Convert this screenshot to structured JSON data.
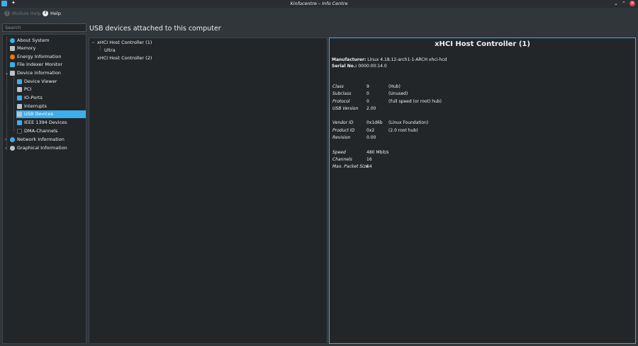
{
  "window": {
    "title": "Kinfocentre – Info Centre",
    "pin_icon": "pin-icon",
    "controls": [
      "minimize-icon",
      "maximize-icon",
      "close-icon"
    ]
  },
  "toolbar": {
    "module_help": "Module Help",
    "help": "Help"
  },
  "search": {
    "placeholder": "Search"
  },
  "sidebar": {
    "items": [
      {
        "label": "About System",
        "icon": "info-icon",
        "color": "#3daee9"
      },
      {
        "label": "Memory",
        "icon": "memory-icon",
        "color": "#bdc3c7"
      },
      {
        "label": "Energy Information",
        "icon": "battery-icon",
        "color": "#f67400"
      },
      {
        "label": "File Indexer Monitor",
        "icon": "indexer-icon",
        "color": "#3daee9"
      },
      {
        "label": "Device Information",
        "icon": "computer-icon",
        "color": "#bdc3c7"
      },
      {
        "label": "Device Viewer",
        "icon": "device-viewer-icon",
        "color": "#3daee9"
      },
      {
        "label": "PCI",
        "icon": "pci-icon",
        "color": "#bdc3c7"
      },
      {
        "label": "IO-Ports",
        "icon": "io-ports-icon",
        "color": "#3daee9"
      },
      {
        "label": "Interrupts",
        "icon": "interrupts-icon",
        "color": "#bdc3c7"
      },
      {
        "label": "USB Devices",
        "icon": "usb-icon",
        "color": "#bdc3c7"
      },
      {
        "label": "IEEE 1394 Devices",
        "icon": "firewire-icon",
        "color": "#3daee9"
      },
      {
        "label": "DMA-Channels",
        "icon": "dma-icon",
        "color": "#1d1f22"
      },
      {
        "label": "Network Information",
        "icon": "network-icon",
        "color": "#3daee9"
      },
      {
        "label": "Graphical Information",
        "icon": "graphics-icon",
        "color": "#bdc3c7"
      }
    ]
  },
  "page_title": "USB devices attached to this computer",
  "devices": [
    {
      "label": "xHCI Host Controller (1)"
    },
    {
      "label": "Ultra"
    },
    {
      "label": "xHCI Host Controller (2)"
    }
  ],
  "details": {
    "title": "xHCI Host Controller (1)",
    "manufacturer_label": "Manufacturer:",
    "manufacturer_value": "Linux 4.18.12-arch1-1-ARCH xhci-hcd",
    "serial_label": "Serial No.:",
    "serial_value": "0000:00:14.0",
    "rows": [
      {
        "k": "Class",
        "v": "9",
        "n": "(Hub)"
      },
      {
        "k": "Subclass",
        "v": "0",
        "n": "(Unused)"
      },
      {
        "k": "Protocol",
        "v": "0",
        "n": "(Full speed (or root) hub)"
      },
      {
        "k": "USB Version",
        "v": "2.00",
        "n": ""
      },
      {
        "k": "Vendor ID",
        "v": "0x1d6b",
        "n": "(Linux Foundation)"
      },
      {
        "k": "Product ID",
        "v": "0x2",
        "n": "(2.0 root hub)"
      },
      {
        "k": "Revision",
        "v": "0.00",
        "n": ""
      },
      {
        "k": "Speed",
        "v": "480 Mbit/s",
        "n": ""
      },
      {
        "k": "Channels",
        "v": "16",
        "n": ""
      },
      {
        "k": "Max. Packet Size",
        "v": "64",
        "n": ""
      }
    ]
  }
}
